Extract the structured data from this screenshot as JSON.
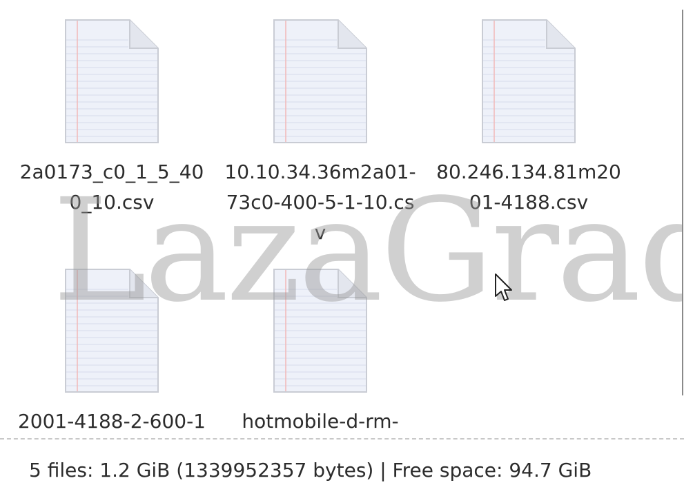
{
  "files": [
    {
      "name": "2a0173_c0_1_5_400_10.csv",
      "icon": "text-document-icon"
    },
    {
      "name": "10.10.34.36m2a01-73c0-400-5-1-10.csv",
      "icon": "text-document-icon"
    },
    {
      "name": "80.246.134.81m2001-4188.csv",
      "icon": "text-document-icon"
    },
    {
      "name": "2001-4188-2-600-1",
      "icon": "text-document-icon"
    },
    {
      "name": "hotmobile-d-rm-",
      "icon": "text-document-icon"
    }
  ],
  "status": {
    "text": "5 files: 1.2 GiB (1339952357 bytes)  |  Free space: 94.7 GiB"
  },
  "watermark": "LazaGrad",
  "cursor_icon": "mouse-pointer-icon"
}
